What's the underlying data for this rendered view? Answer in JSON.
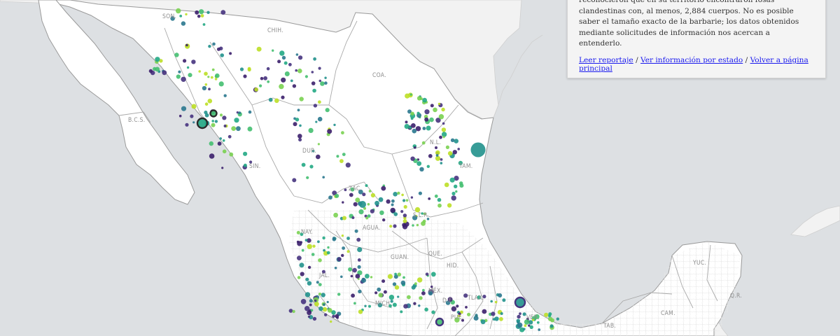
{
  "map": {
    "colors": {
      "water": "#dde0e3",
      "foreign_land": "#f2f2f2",
      "mexico_land": "#ffffff",
      "state_border": "#9a9a9a",
      "municipal_border": "#e3e3e3",
      "dot_palette": [
        "#3b1f6b",
        "#46337e",
        "#2a788e",
        "#21918c",
        "#22a884",
        "#44bf70",
        "#7ad151",
        "#bddf26"
      ]
    },
    "state_labels": [
      "SON.",
      "CHIH.",
      "COA.",
      "B.C.S.",
      "N.L.",
      "DUR.",
      "SIN.",
      "TAM.",
      "ZAC.",
      "S.L.P.",
      "NAY.",
      "AGUA.",
      "QUE.",
      "GUAN.",
      "HID.",
      "JAL.",
      "YUC.",
      "Q.R.",
      "CAM.",
      "MÉX.",
      "D.F.",
      "MICH.",
      "PUE.",
      "TLAX.",
      "VER.",
      "TAB."
    ]
  },
  "infobox": {
    "description": "reconocieron que en su territorio encontraron fosas clandestinas con, al menos, 2,884 cuerpos. No es posible saber el tamaño exacto de la barbarie; los datos obtenidos mediante solicitudes de información nos acercan a entenderlo.",
    "links": {
      "read_report": "Leer reportaje",
      "by_state": "Ver información por estado",
      "back_home": "Volver a página principal",
      "separator": "/"
    }
  }
}
